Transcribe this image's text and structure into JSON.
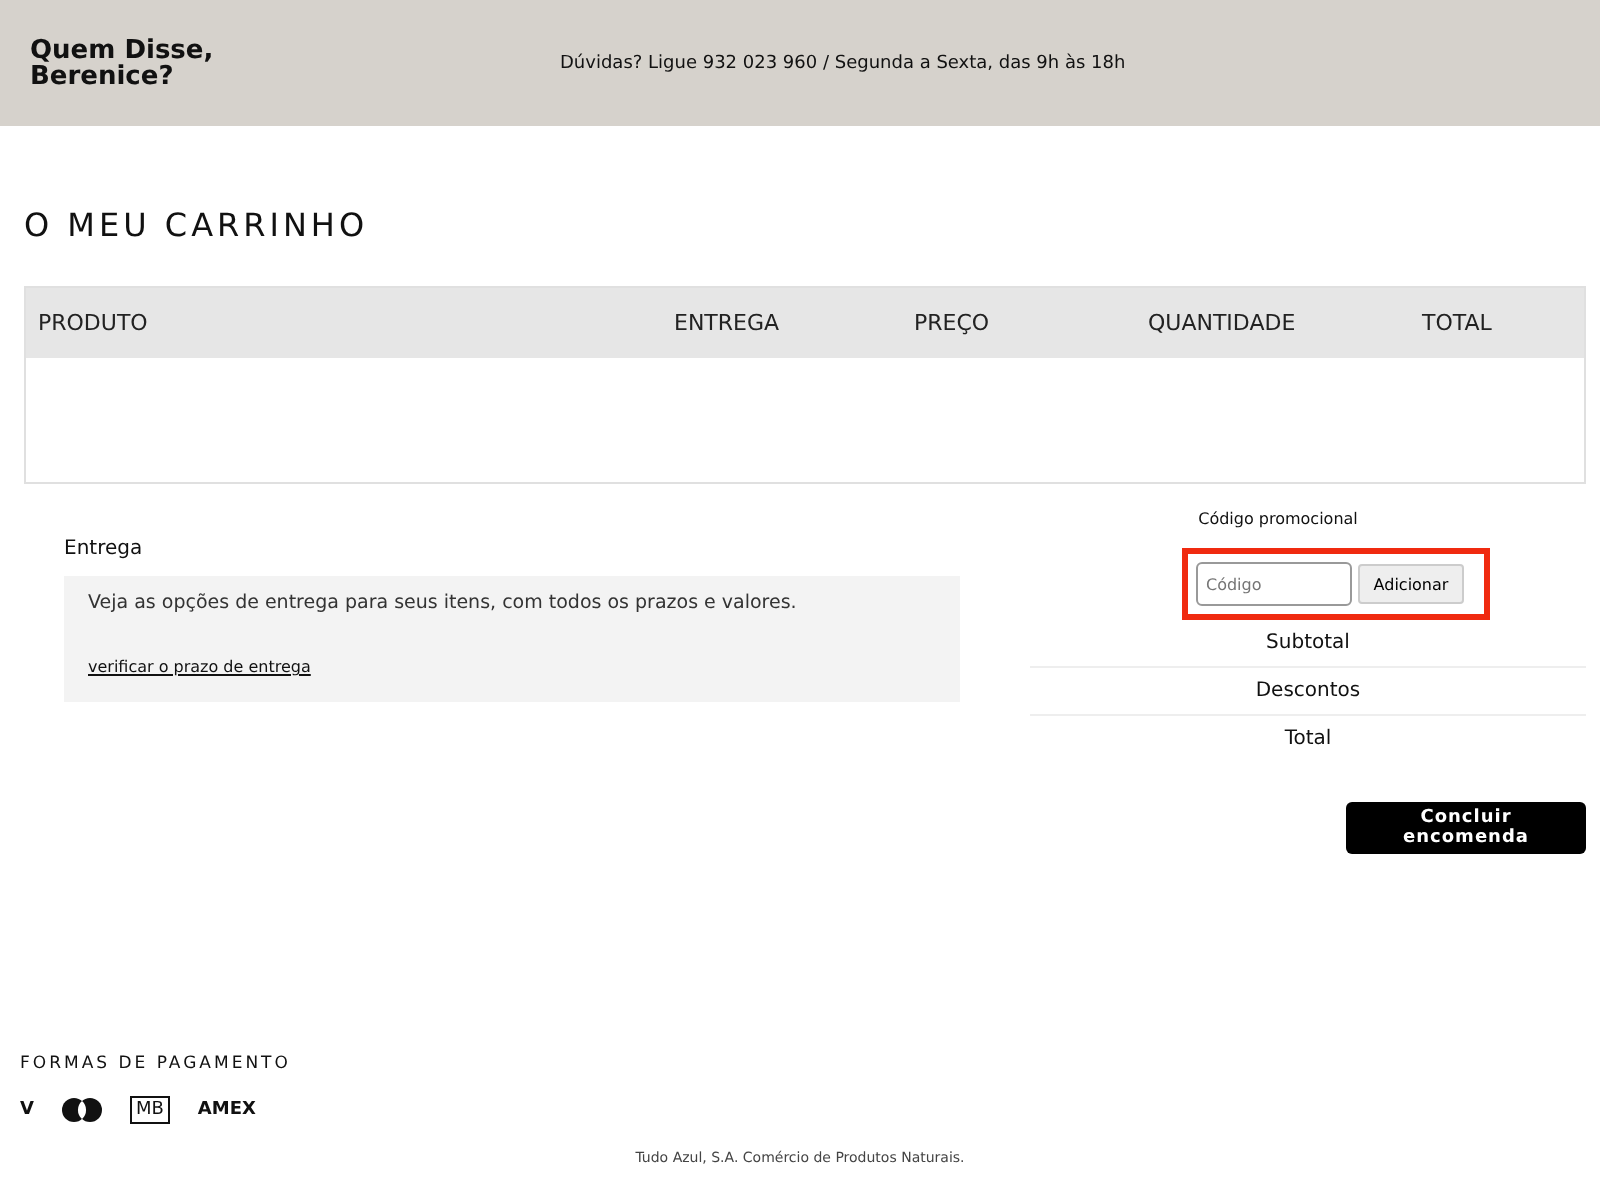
{
  "header": {
    "logo": [
      "Quem Disse,",
      "Berenice?"
    ],
    "contact": "Dúvidas? Ligue 932 023 960 / Segunda a Sexta, das 9h às 18h"
  },
  "page_title": "O MEU CARRINHO",
  "table": {
    "columns": [
      "PRODUTO",
      "ENTREGA",
      "PREÇO",
      "QUANTIDADE",
      "TOTAL"
    ]
  },
  "delivery": {
    "title": "Entrega",
    "text": "Veja as opções de entrega para seus itens, com todos os prazos e valores.",
    "link": "verificar o prazo de entrega"
  },
  "promo": {
    "label": "Código promocional",
    "placeholder": "Código",
    "button": "Adicionar",
    "highlighted": true
  },
  "summary": [
    "Subtotal",
    "Descontos",
    "Total"
  ],
  "checkout_button": "Concluir encomenda",
  "footer": {
    "payment_title": "FORMAS DE PAGAMENTO",
    "payment_methods": [
      {
        "kind": "text",
        "label": "V"
      },
      {
        "kind": "circles"
      },
      {
        "kind": "boxed",
        "label": "MB"
      },
      {
        "kind": "text",
        "label": "AMEX"
      }
    ],
    "company": "Tudo Azul, S.A. Comércio de Produtos Naturais."
  }
}
